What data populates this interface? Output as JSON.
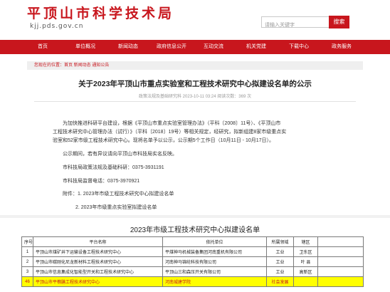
{
  "header": {
    "site_name": "平顶山市科学技术局",
    "site_url": "kjj.pds.gov.cn",
    "search_placeholder": "请输入关键字",
    "search_button": "搜索"
  },
  "nav": [
    {
      "label": "首页"
    },
    {
      "label": "单位概况"
    },
    {
      "label": "新闻动态"
    },
    {
      "label": "政府信息公开"
    },
    {
      "label": "互动交流"
    },
    {
      "label": "机关党建"
    },
    {
      "label": "下载中心"
    },
    {
      "label": "政务服务"
    }
  ],
  "breadcrumb": "您现在的位置：首页 新闻动态 通知公告",
  "article": {
    "title": "关于2023年平顶山市重点实验室和工程技术研究中心拟建设名单的公示",
    "meta": "政策法规及基础研究科  2023-10-11 03:24  阅读次数：369 次",
    "paragraphs": [
      "为加快推进科研平台建设，根据《平顶山市重点实验室管理办法》（平科〔2008〕11号）、《平顶山市",
      "工程技术研究中心管理办法（试行）》（平科〔2018〕19号）等相关规定，经研究，拟新组建8家市级重点实",
      "验室和52家市级工程技术研究中心。现将名单予以公示，公示期5个工作日（10月11日 - 10月17日）。",
      "公示期间，若有异议请向平顶山市科技局实名反映。",
      "市科技局政策法规及基础科研：0375-3931191",
      "市科技局监督电话：0375-3970921",
      "附件：1. 2023年市级工程技术研究中心拟建设名单",
      "2. 2023年市级重点实验室拟建设名单"
    ]
  },
  "attachment": {
    "title": "2023年市级工程技术研究中心拟建设名单",
    "columns": [
      "序号",
      "平台名称",
      "依托单位",
      "所属领域",
      "辖区"
    ],
    "rows": [
      [
        "1",
        "平顶山市煤矿井下运输设备工程技术研究中心",
        "平煤神马机械装备集团河南重机有限公司",
        "工业",
        "卫东区"
      ],
      [
        "2",
        "平顶山市碳刚化尼龙新材料工程技术研究中心",
        "河南神马锦纶科技有限公司",
        "工业",
        "叶 县"
      ],
      [
        "3",
        "平顶山市信息集成化智能型开关和工程技术研究中心",
        "平顶山三和森压开关有限公司",
        "工业",
        "高新区"
      ],
      [
        "46",
        "平顶山市平樵膳工程技术研究中心",
        "河南城建学院",
        "社会发展",
        ""
      ]
    ]
  },
  "colors": {
    "brand_red": "#c8161d",
    "highlight_yellow": "#ffff00"
  }
}
